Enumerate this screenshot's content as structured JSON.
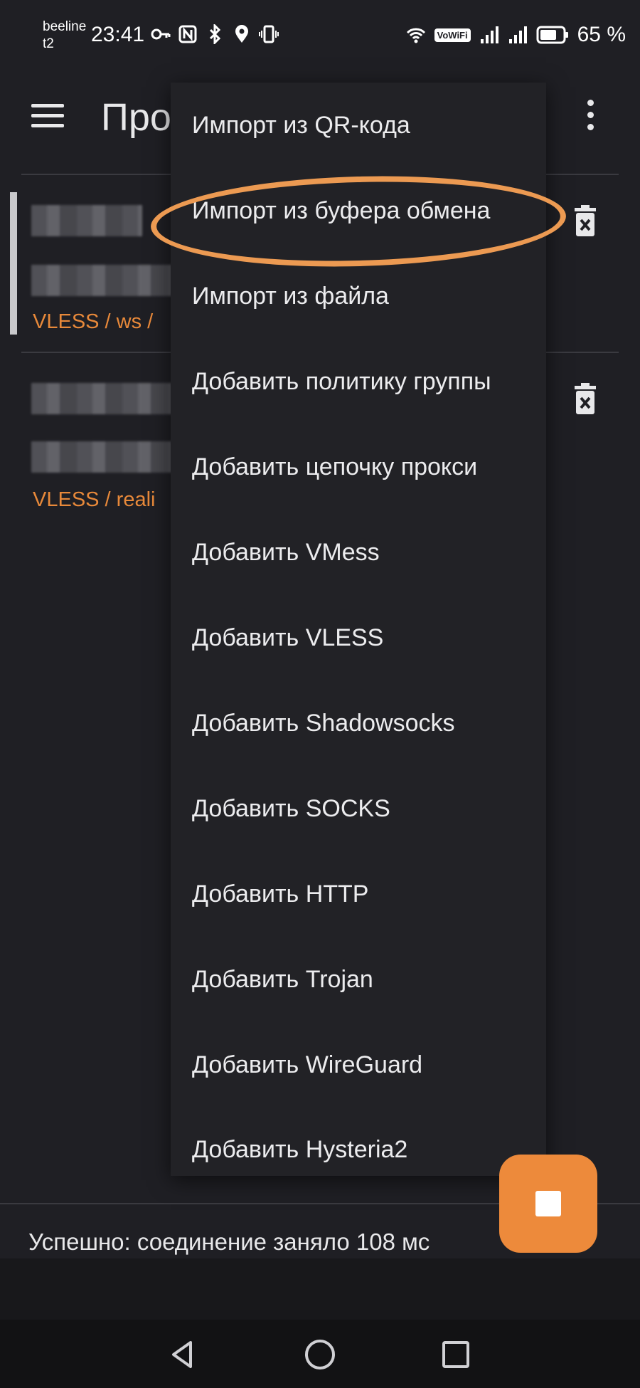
{
  "status_bar": {
    "carrier_line1": "beeline",
    "carrier_line2": "t2",
    "time": "23:41",
    "vowifi": "VoWiFi",
    "battery_percent": "65 %",
    "icons": [
      "key-icon",
      "nfc-icon",
      "bluetooth-icon",
      "location-icon",
      "vibrate-icon",
      "wifi-icon",
      "signal-icon",
      "signal-icon",
      "battery-icon"
    ]
  },
  "app_bar": {
    "title": "Про"
  },
  "proxies": [
    {
      "type_label": "VLESS / ws /",
      "selected": true
    },
    {
      "type_label": "VLESS / reali",
      "selected": false
    }
  ],
  "menu": {
    "items": [
      "Импорт из QR-кода",
      "Импорт из буфера обмена",
      "Импорт из файла",
      "Добавить политику группы",
      "Добавить цепочку прокси",
      "Добавить VMess",
      "Добавить VLESS",
      "Добавить Shadowsocks",
      "Добавить SOCKS",
      "Добавить HTTP",
      "Добавить Trojan",
      "Добавить WireGuard",
      "Добавить Hysteria2"
    ],
    "highlighted_index": 1
  },
  "status_message": "Успешно: соединение заняло 108 мс",
  "colors": {
    "background": "#1f1f24",
    "accent": "#ed8a3b",
    "highlight_stroke": "#ec9a52",
    "proxy_type_text": "#e8893a"
  }
}
